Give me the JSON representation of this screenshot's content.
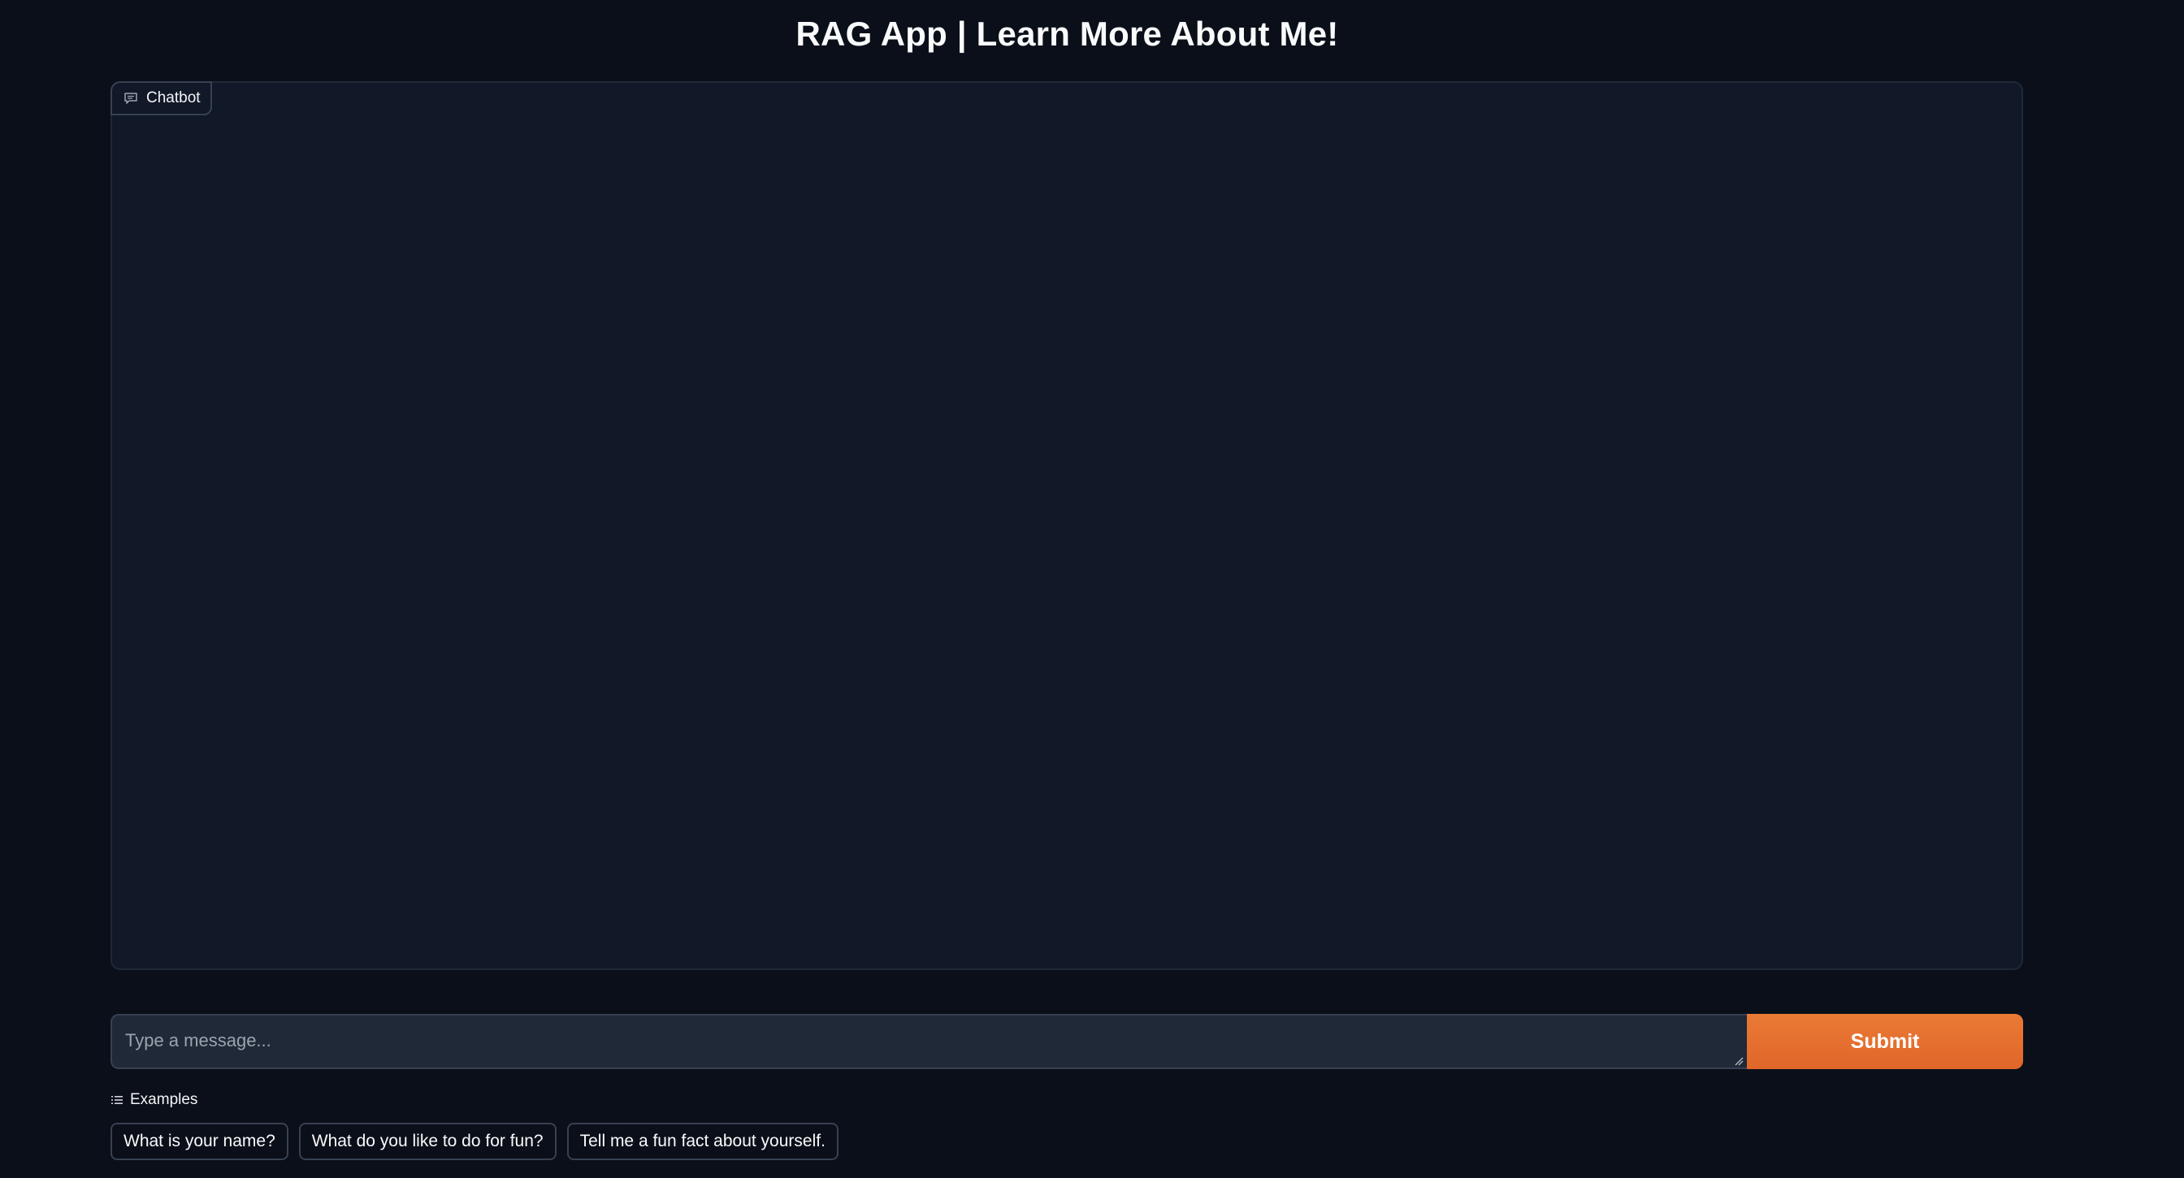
{
  "app": {
    "title": "RAG App | Learn More About Me!"
  },
  "chatbot": {
    "label": "Chatbot",
    "icon": "chat-bubble-icon"
  },
  "input": {
    "placeholder": "Type a message...",
    "value": ""
  },
  "submit": {
    "label": "Submit"
  },
  "examples": {
    "label": "Examples",
    "icon": "list-icon",
    "items": [
      "What is your name?",
      "What do you like to do for fun?",
      "Tell me a fun fact about yourself."
    ]
  },
  "colors": {
    "background": "#0b0f19",
    "panel": "#111827",
    "accent": "#e97331"
  }
}
